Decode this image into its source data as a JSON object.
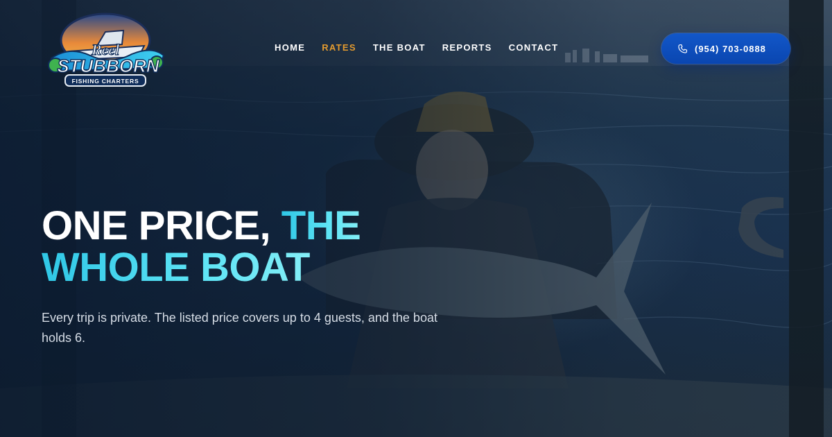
{
  "brand": {
    "logo_line1": "Reel",
    "logo_line2": "STUBBORN",
    "logo_tagline": "FISHING CHARTERS"
  },
  "nav": {
    "items": [
      {
        "label": "HOME",
        "active": false
      },
      {
        "label": "RATES",
        "active": true
      },
      {
        "label": "THE BOAT",
        "active": false
      },
      {
        "label": "REPORTS",
        "active": false
      },
      {
        "label": "CONTACT",
        "active": false
      }
    ]
  },
  "phone": {
    "label": "(954) 703-0888",
    "icon": "phone-icon"
  },
  "hero": {
    "headline_white": "ONE PRICE, ",
    "headline_accent_a": "THE",
    "headline_accent_b": "WHOLE BOAT",
    "subtext": "Every trip is private. The listed price covers up to 4 guests, and the boat holds 6."
  },
  "colors": {
    "active_nav": "#e39b2f",
    "accent_cyan": "#47d6ee",
    "button_blue": "#0d4fbf"
  }
}
